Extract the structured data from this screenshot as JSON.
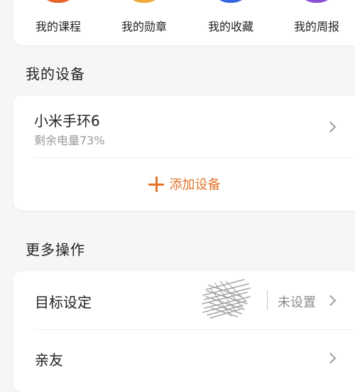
{
  "colors": {
    "shortcut_course": "#e8632a",
    "shortcut_medal": "#f2a93b",
    "shortcut_favorites": "#3467e0",
    "shortcut_weekly": "#8b4fd6",
    "accent": "#e2732b"
  },
  "shortcuts": [
    {
      "label": "我的课程",
      "icon": "course-icon"
    },
    {
      "label": "我的勋章",
      "icon": "medal-icon"
    },
    {
      "label": "我的收藏",
      "icon": "favorites-icon"
    },
    {
      "label": "我的周报",
      "icon": "weekly-report-icon"
    }
  ],
  "devices": {
    "section_title": "我的设备",
    "device_name": "小米手环6",
    "battery_text": "剩余电量73%",
    "add_label": "添加设备"
  },
  "operations": {
    "section_title": "更多操作",
    "goal_label": "目标设定",
    "goal_value": "未设置",
    "friends_label": "亲友"
  }
}
